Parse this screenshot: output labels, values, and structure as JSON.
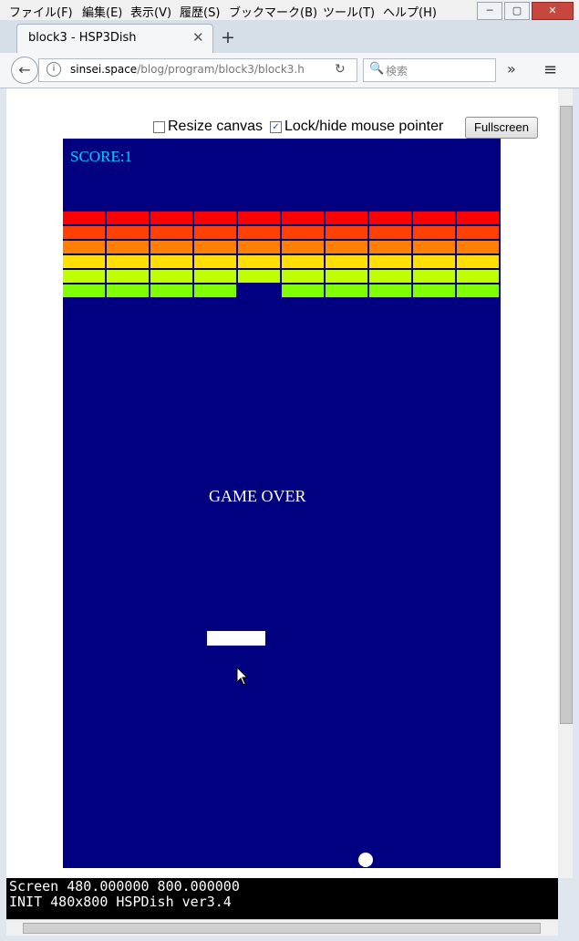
{
  "menu": [
    "ファイル(F)",
    "編集(E)",
    "表示(V)",
    "履歴(S)",
    "ブックマーク(B)",
    "ツール(T)",
    "ヘルプ(H)"
  ],
  "window_controls": [
    "─",
    "▢",
    "✕"
  ],
  "tab": {
    "title": "block3 - HSP3Dish",
    "close": "✕",
    "new_tab": "+"
  },
  "nav": {
    "back": "←",
    "info": "i",
    "url_host": "sinsei.space",
    "url_path": "/blog/program/block3/block3.h",
    "reload": "↻",
    "search_icon": "🔍",
    "search_placeholder": "検索",
    "overflow": "»",
    "menu_icon": "≡"
  },
  "controls": {
    "resize_label": "Resize canvas",
    "resize_checked": false,
    "lock_label": "Lock/hide mouse pointer",
    "lock_checked": true,
    "check_mark": "✓",
    "fullscreen": "Fullscreen"
  },
  "game": {
    "score": "SCORE:1",
    "message": "GAME OVER",
    "background": "#000080",
    "row_colors": [
      "#ff0000",
      "#ff4000",
      "#ff8000",
      "#ffe000",
      "#c0ff00",
      "#80ff00"
    ],
    "missing_bricks": [
      [
        5,
        4
      ]
    ],
    "columns": 10,
    "rows": 6
  },
  "console": {
    "line1": "Screen 480.000000 800.000000",
    "line2": "INIT 480x800 HSPDish ver3.4"
  }
}
